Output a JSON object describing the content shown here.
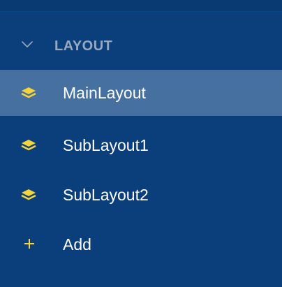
{
  "colors": {
    "panel_background": "#0a3f7c",
    "active_item_background": "#45709f",
    "icon_accent": "#f5d33d",
    "section_title": "#97a9bf",
    "item_text": "#ffffff"
  },
  "section": {
    "title": "LAYOUT",
    "expanded": true,
    "toggle_icon": "chevron-down-icon"
  },
  "items": [
    {
      "label": "MainLayout",
      "icon": "layers-icon",
      "active": true
    },
    {
      "label": "SubLayout1",
      "icon": "layers-icon",
      "active": false
    },
    {
      "label": "SubLayout2",
      "icon": "layers-icon",
      "active": false
    },
    {
      "label": "Add",
      "icon": "plus-icon",
      "active": false
    }
  ]
}
